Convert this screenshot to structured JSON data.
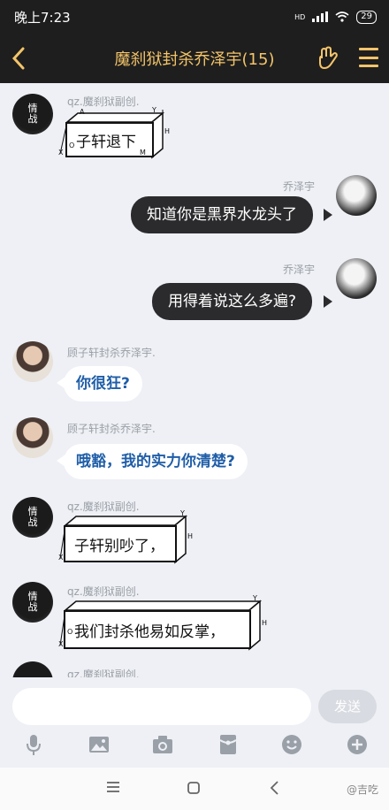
{
  "status": {
    "time": "晚上7:23",
    "net": "HD",
    "battery": "29"
  },
  "header": {
    "title": "魔刹狱封杀乔泽宇(15)"
  },
  "messages": [
    {
      "sender": "qz.魔刹狱副创.",
      "sticker_text": "子轩退下"
    },
    {
      "sender": "乔泽宇",
      "text": "知道你是黑界水龙头了"
    },
    {
      "sender": "乔泽宇",
      "text": "用得着说这么多遍?"
    },
    {
      "sender": "顾子轩封杀乔泽宇.",
      "text": "你很狂?"
    },
    {
      "sender": "顾子轩封杀乔泽宇.",
      "text": "哦豁，我的实力你清楚?"
    },
    {
      "sender": "qz.魔刹狱副创.",
      "sticker_text": "子轩别吵了，"
    },
    {
      "sender": "qz.魔刹狱副创.",
      "sticker_text": "我们封杀他易如反掌，"
    },
    {
      "sender": "qz.魔刹狱副创."
    }
  ],
  "avatar_text": {
    "line1": "情",
    "line2": "战"
  },
  "sticker_axis": {
    "x": "X",
    "y": "Y",
    "h": "H",
    "a": "A",
    "o": "O",
    "m": "M"
  },
  "input": {
    "placeholder": "",
    "send_label": "发送"
  },
  "toolbar": [
    "microphone-icon",
    "image-icon",
    "camera-icon",
    "red-packet-icon",
    "emoji-icon",
    "plus-icon"
  ],
  "watermark": "@吉吃",
  "colors": {
    "header_bg": "#1e1e1e",
    "accent": "#f3c46a",
    "bubble_dark": "#2b2b2d",
    "bubble_light_text": "#1f5ea8"
  }
}
